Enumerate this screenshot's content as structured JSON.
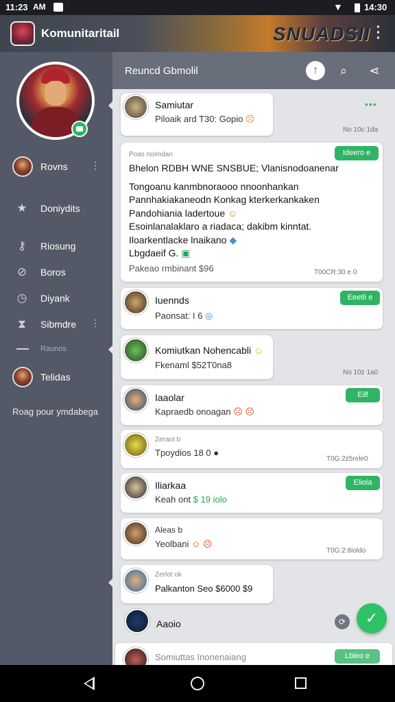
{
  "status_bar": {
    "time": "11:23",
    "carrier": "AM",
    "time_right": "14:30"
  },
  "header": {
    "title": "Komunitaritail",
    "banner_text": "SNUADSII"
  },
  "sidebar": {
    "items": [
      {
        "label": "Rovns",
        "icon": "user-avatar"
      },
      {
        "label": "Doniydits",
        "icon": "star-icon"
      },
      {
        "label": "Riosung",
        "icon": "key-icon"
      },
      {
        "label": "Boros",
        "icon": "search-icon"
      },
      {
        "label": "Diyank",
        "icon": "clock-icon"
      },
      {
        "label": "Sibmdre",
        "icon": "hourglass-icon"
      },
      {
        "label": "Raunos",
        "icon": "dash-icon"
      },
      {
        "label": "Telidas",
        "icon": "user-avatar"
      }
    ],
    "footer": "Roag pour ymdabega"
  },
  "main_header": {
    "title": "Reuncd Gbmolil"
  },
  "cards": {
    "c1": {
      "name": "Samiutar",
      "text": "Piloaik ard T30: Gopio",
      "time": "No 10c 1da"
    },
    "c2": {
      "label": "Poas noimdan",
      "title": "Bhelon RDBH WNE SNSBUE; Vlanisnodoanenar",
      "lines": [
        "Tongoanu kanmbnoraooo nnoonhankan",
        "Pannhakiakaneodn Konkag kterkerkankaken",
        "Pandohiania ladertoue",
        "Esoinlanalaklaro a riadaca; dakibm kinntat.",
        "Iloarkentlacke lnaikano",
        "Lbgdaeif G."
      ],
      "footer": "Pakeao rmbinant $96",
      "badge": "Ideero e",
      "time": "T00CR:30 e 0"
    },
    "c3": {
      "name": "Iuennds",
      "text": "Paonsat: I 6",
      "badge": "Eeetli e"
    },
    "c4": {
      "name": "Komiutkan Nohencabli",
      "text": "Fkenaml $52T0na8",
      "time": "No 10z 1a0"
    },
    "c5": {
      "name": "Iaaolar",
      "text": "Kapraedb onoagan",
      "badge": "Eilf"
    },
    "c6": {
      "label": "Zeraot b",
      "text": "Tpoydios 18 0",
      "time": "T0G:2z5rele0"
    },
    "c7": {
      "name": "Iliarkaa",
      "text": "Keah ont",
      "amount": "$ 19 iolo",
      "badge": "Eliola"
    },
    "c8": {
      "name": "Aleas b",
      "text": "Yeolbani",
      "time": "T0G:2:8ioldo"
    },
    "c9": {
      "label": "Zerlot ok",
      "text": "Palkanton Seo $6000 $9"
    },
    "c10": {
      "name": "Aaoio"
    },
    "c11": {
      "text": "Somiuttas Inonenaiang",
      "badge": "Lbleo e"
    }
  },
  "colors": {
    "accent": "#2fb463",
    "sidebar": "#535966",
    "main_bg": "#e3e4e7"
  }
}
